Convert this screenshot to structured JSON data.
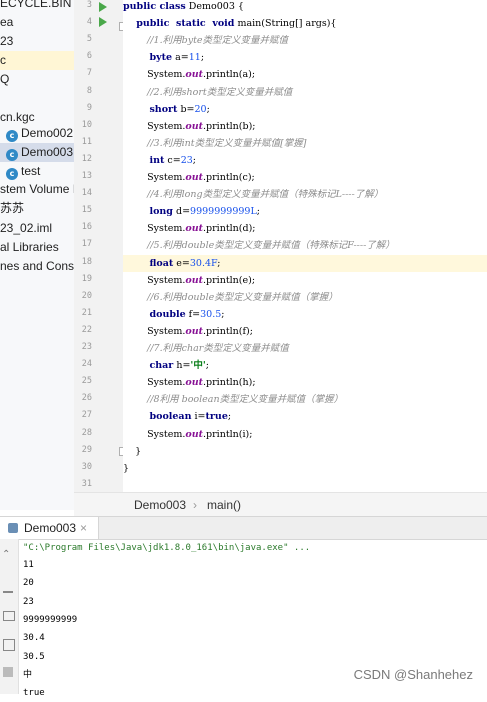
{
  "project_tree": [
    {
      "label": "ECYCLE.BIN",
      "icon": "",
      "state": ""
    },
    {
      "label": "ea",
      "icon": "",
      "state": ""
    },
    {
      "label": "23",
      "icon": "",
      "state": ""
    },
    {
      "label": "c",
      "icon": "",
      "state": "highlight"
    },
    {
      "label": "Q",
      "icon": "",
      "state": ""
    },
    {
      "label": "",
      "icon": "",
      "state": ""
    },
    {
      "label": "cn.kgc",
      "icon": "",
      "state": ""
    },
    {
      "label": "Demo002",
      "icon": "c",
      "state": ""
    },
    {
      "label": "Demo003",
      "icon": "c",
      "state": "selected"
    },
    {
      "label": "test",
      "icon": "c",
      "state": ""
    },
    {
      "label": "stem Volume In",
      "icon": "",
      "state": ""
    },
    {
      "label": "苏苏",
      "icon": "",
      "state": ""
    },
    {
      "label": "23_02.iml",
      "icon": "",
      "state": ""
    },
    {
      "label": "al Libraries",
      "icon": "",
      "state": ""
    },
    {
      "label": "nes and Conso",
      "icon": "",
      "state": ""
    }
  ],
  "editor": {
    "line_numbers": [
      "3",
      "4",
      "5",
      "6",
      "7",
      "8",
      "9",
      "10",
      "11",
      "12",
      "13",
      "14",
      "15",
      "16",
      "17",
      "18",
      "19",
      "20",
      "21",
      "22",
      "23",
      "24",
      "25",
      "26",
      "27",
      "28",
      "29",
      "30",
      "31"
    ],
    "current_line": "18",
    "lines": [
      [
        {
          "t": "public class",
          "c": "kw"
        },
        {
          "t": " Demo003 {",
          "c": ""
        }
      ],
      [
        {
          "t": "    public  static  void",
          "c": "kw"
        },
        {
          "t": " main(String[] args){",
          "c": ""
        }
      ],
      [
        {
          "t": "        //1.利用byte类型定义变量并赋值",
          "c": "cm"
        }
      ],
      [
        {
          "t": "        byte",
          "c": "kw"
        },
        {
          "t": " a=",
          "c": ""
        },
        {
          "t": "11",
          "c": "num"
        },
        {
          "t": ";",
          "c": ""
        }
      ],
      [
        {
          "t": "        System.",
          "c": ""
        },
        {
          "t": "out",
          "c": "fld"
        },
        {
          "t": ".println(a);",
          "c": ""
        }
      ],
      [
        {
          "t": "        //2.利用short类型定义变量并赋值",
          "c": "cm"
        }
      ],
      [
        {
          "t": "        short",
          "c": "kw"
        },
        {
          "t": " b=",
          "c": ""
        },
        {
          "t": "20",
          "c": "num"
        },
        {
          "t": ";",
          "c": ""
        }
      ],
      [
        {
          "t": "        System.",
          "c": ""
        },
        {
          "t": "out",
          "c": "fld"
        },
        {
          "t": ".println(b);",
          "c": ""
        }
      ],
      [
        {
          "t": "        //3.利用int类型定义变量并赋值[掌握]",
          "c": "cm"
        }
      ],
      [
        {
          "t": "        int",
          "c": "kw"
        },
        {
          "t": " c=",
          "c": ""
        },
        {
          "t": "23",
          "c": "num"
        },
        {
          "t": ";",
          "c": ""
        }
      ],
      [
        {
          "t": "        System.",
          "c": ""
        },
        {
          "t": "out",
          "c": "fld"
        },
        {
          "t": ".println(c);",
          "c": ""
        }
      ],
      [
        {
          "t": "        //4.利用long类型定义变量并赋值（特殊标记L----了解）",
          "c": "cm"
        }
      ],
      [
        {
          "t": "        long",
          "c": "kw"
        },
        {
          "t": " d=",
          "c": ""
        },
        {
          "t": "9999999999L",
          "c": "num"
        },
        {
          "t": ";",
          "c": ""
        }
      ],
      [
        {
          "t": "        System.",
          "c": ""
        },
        {
          "t": "out",
          "c": "fld"
        },
        {
          "t": ".println(d);",
          "c": ""
        }
      ],
      [
        {
          "t": "        //5.利用double类型定义变量并赋值（特殊标记F----了解）",
          "c": "cm"
        }
      ],
      [
        {
          "t": "        float",
          "c": "kw"
        },
        {
          "t": " e=",
          "c": ""
        },
        {
          "t": "30.4F",
          "c": "num"
        },
        {
          "t": ";",
          "c": ""
        }
      ],
      [
        {
          "t": "        System.",
          "c": ""
        },
        {
          "t": "out",
          "c": "fld"
        },
        {
          "t": ".println(e);",
          "c": ""
        }
      ],
      [
        {
          "t": "        //6.利用double类型定义变量并赋值（掌握）",
          "c": "cm"
        }
      ],
      [
        {
          "t": "        double",
          "c": "kw"
        },
        {
          "t": " f=",
          "c": ""
        },
        {
          "t": "30.5",
          "c": "num"
        },
        {
          "t": ";",
          "c": ""
        }
      ],
      [
        {
          "t": "        System.",
          "c": ""
        },
        {
          "t": "out",
          "c": "fld"
        },
        {
          "t": ".println(f);",
          "c": ""
        }
      ],
      [
        {
          "t": "        //7.利用char类型定义变量并赋值",
          "c": "cm"
        }
      ],
      [
        {
          "t": "        char",
          "c": "kw"
        },
        {
          "t": " h=",
          "c": ""
        },
        {
          "t": "'中'",
          "c": "str"
        },
        {
          "t": ";",
          "c": ""
        }
      ],
      [
        {
          "t": "        System.",
          "c": ""
        },
        {
          "t": "out",
          "c": "fld"
        },
        {
          "t": ".println(h);",
          "c": ""
        }
      ],
      [
        {
          "t": "        //8利用 boolean类型定义变量并赋值（掌握）",
          "c": "cm"
        }
      ],
      [
        {
          "t": "        boolean",
          "c": "kw"
        },
        {
          "t": " i=",
          "c": ""
        },
        {
          "t": "true",
          "c": "kw"
        },
        {
          "t": ";",
          "c": ""
        }
      ],
      [
        {
          "t": "        System.",
          "c": ""
        },
        {
          "t": "out",
          "c": "fld"
        },
        {
          "t": ".println(i);",
          "c": ""
        }
      ],
      [
        {
          "t": "    }",
          "c": ""
        }
      ],
      [
        {
          "t": "}",
          "c": ""
        }
      ],
      [
        {
          "t": "",
          "c": ""
        }
      ]
    ]
  },
  "breadcrumb": {
    "file": "Demo003",
    "separator": "›",
    "method": "main()"
  },
  "run_panel": {
    "tab_label": "Demo003",
    "close_glyph": "×",
    "command": "\"C:\\Program Files\\Java\\jdk1.8.0_161\\bin\\java.exe\" ...",
    "output": [
      "11",
      "20",
      "23",
      "9999999999",
      "30.4",
      "30.5",
      "中",
      "true"
    ]
  },
  "watermark": "CSDN @Shanhehez",
  "colors": {
    "keyword": "#000080",
    "comment": "#8c8c8c",
    "number": "#1750eb",
    "current_line": "#fff8dc",
    "run_green": "#4aa84a"
  }
}
